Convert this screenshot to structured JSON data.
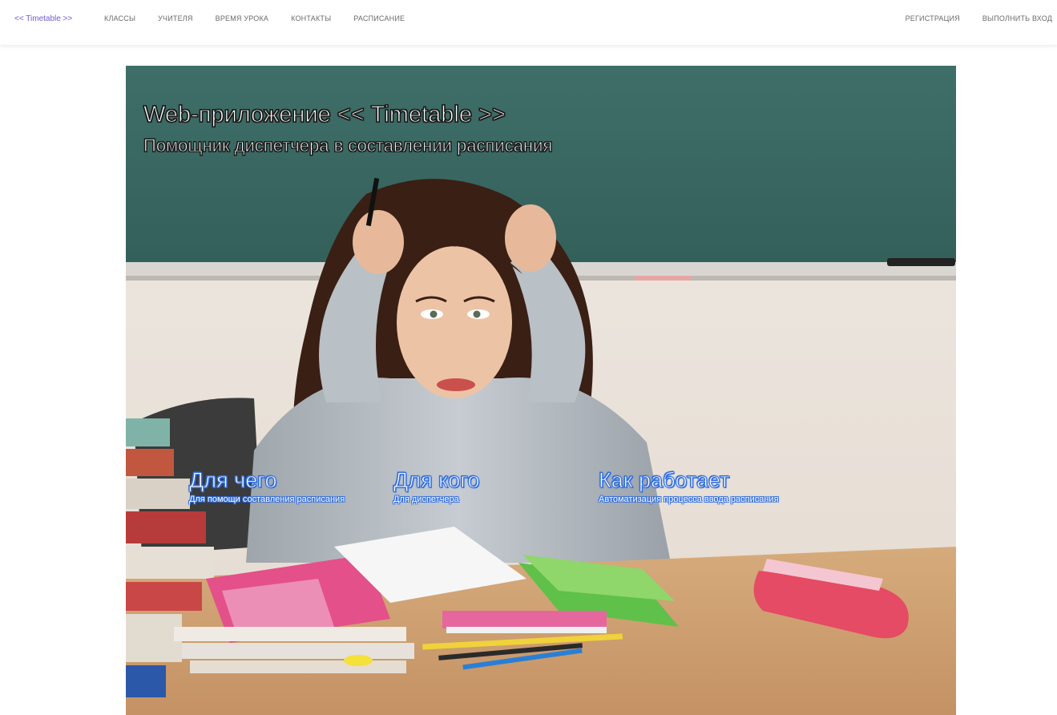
{
  "nav": {
    "brand": "<< Timetable >>",
    "left_links": [
      "КЛАССЫ",
      "УЧИТЕЛЯ",
      "ВРЕМЯ УРОКА",
      "КОНТАКТЫ",
      "РАСПИСАНИЕ"
    ],
    "right_links": [
      "РЕГИСТРАЦИЯ",
      "ВЫПОЛНИТЬ ВХОД"
    ]
  },
  "hero": {
    "title": "Web-приложение << Timetable >>",
    "subtitle": "Помощник диспетчера в составлении расписания",
    "features": [
      {
        "title": "Для чего",
        "text": "Для помощи составления расписания"
      },
      {
        "title": "Для кого",
        "text": "Для диспетчера"
      },
      {
        "title": "Как работает",
        "text": "Автоматизация процесса ввода расписания"
      }
    ]
  },
  "colors": {
    "brand": "#6f5bd6",
    "nav_text": "#6a6a6a",
    "chalkboard": "#3b6b64",
    "feature_outline": "#2f6de0"
  }
}
